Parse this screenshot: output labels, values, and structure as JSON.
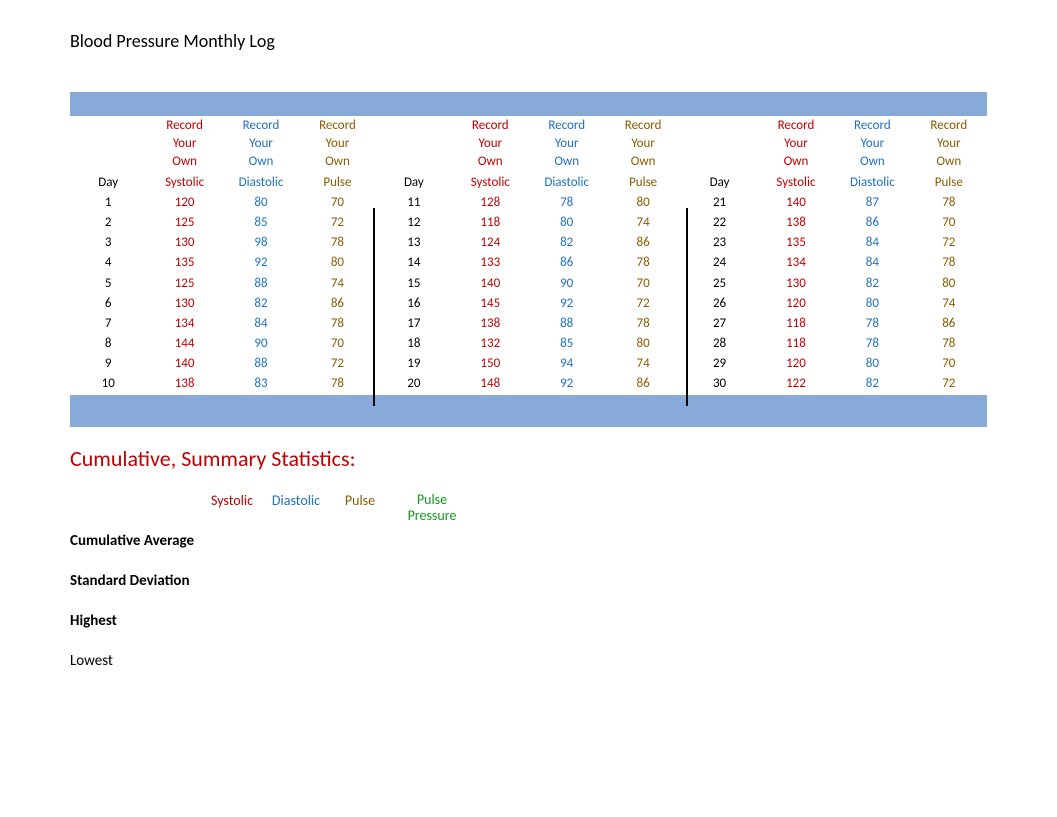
{
  "title": "Blood Pressure Monthly Log",
  "header": {
    "record_your_own": "Record Your Own",
    "day": "Day",
    "systolic": "Systolic",
    "diastolic": "Diastolic",
    "pulse": "Pulse"
  },
  "decades": [
    [
      {
        "day": 1,
        "sys": 120,
        "dia": 80,
        "pul": 70
      },
      {
        "day": 2,
        "sys": 125,
        "dia": 85,
        "pul": 72
      },
      {
        "day": 3,
        "sys": 130,
        "dia": 98,
        "pul": 78
      },
      {
        "day": 4,
        "sys": 135,
        "dia": 92,
        "pul": 80
      },
      {
        "day": 5,
        "sys": 125,
        "dia": 88,
        "pul": 74
      },
      {
        "day": 6,
        "sys": 130,
        "dia": 82,
        "pul": 86
      },
      {
        "day": 7,
        "sys": 134,
        "dia": 84,
        "pul": 78
      },
      {
        "day": 8,
        "sys": 144,
        "dia": 90,
        "pul": 70
      },
      {
        "day": 9,
        "sys": 140,
        "dia": 88,
        "pul": 72
      },
      {
        "day": 10,
        "sys": 138,
        "dia": 83,
        "pul": 78
      }
    ],
    [
      {
        "day": 11,
        "sys": 128,
        "dia": 78,
        "pul": 80
      },
      {
        "day": 12,
        "sys": 118,
        "dia": 80,
        "pul": 74
      },
      {
        "day": 13,
        "sys": 124,
        "dia": 82,
        "pul": 86
      },
      {
        "day": 14,
        "sys": 133,
        "dia": 86,
        "pul": 78
      },
      {
        "day": 15,
        "sys": 140,
        "dia": 90,
        "pul": 70
      },
      {
        "day": 16,
        "sys": 145,
        "dia": 92,
        "pul": 72
      },
      {
        "day": 17,
        "sys": 138,
        "dia": 88,
        "pul": 78
      },
      {
        "day": 18,
        "sys": 132,
        "dia": 85,
        "pul": 80
      },
      {
        "day": 19,
        "sys": 150,
        "dia": 94,
        "pul": 74
      },
      {
        "day": 20,
        "sys": 148,
        "dia": 92,
        "pul": 86
      }
    ],
    [
      {
        "day": 21,
        "sys": 140,
        "dia": 87,
        "pul": 78
      },
      {
        "day": 22,
        "sys": 138,
        "dia": 86,
        "pul": 70
      },
      {
        "day": 23,
        "sys": 135,
        "dia": 84,
        "pul": 72
      },
      {
        "day": 24,
        "sys": 134,
        "dia": 84,
        "pul": 78
      },
      {
        "day": 25,
        "sys": 130,
        "dia": 82,
        "pul": 80
      },
      {
        "day": 26,
        "sys": 120,
        "dia": 80,
        "pul": 74
      },
      {
        "day": 27,
        "sys": 118,
        "dia": 78,
        "pul": 86
      },
      {
        "day": 28,
        "sys": 118,
        "dia": 78,
        "pul": 78
      },
      {
        "day": 29,
        "sys": 120,
        "dia": 80,
        "pul": 70
      },
      {
        "day": 30,
        "sys": 122,
        "dia": 82,
        "pul": 72
      }
    ]
  ],
  "summary": {
    "title": "Cumulative, Summary Statistics:",
    "cols": {
      "systolic": "Systolic",
      "diastolic": "Diastolic",
      "pulse": "Pulse",
      "pulse_pressure": "Pulse Pressure"
    },
    "rows": {
      "avg": "Cumulative Average",
      "std": "Standard Deviation",
      "high": "Highest",
      "low": "Lowest"
    }
  }
}
